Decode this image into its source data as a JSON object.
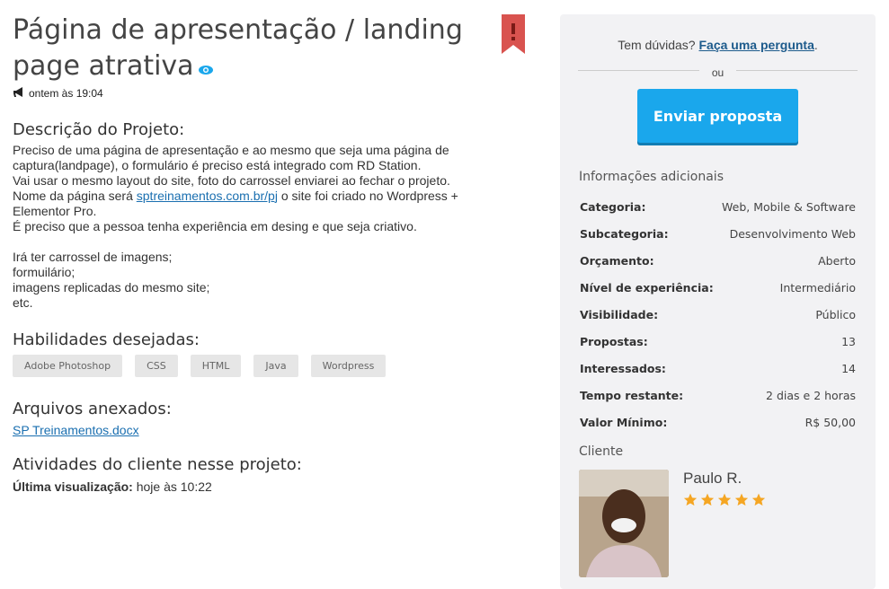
{
  "project": {
    "title": "Página de apresentação / landing page atrativa",
    "posted": "ontem às 19:04"
  },
  "description": {
    "heading": "Descrição do Projeto:",
    "line1": "Preciso de uma página de apresentação e ao mesmo que seja uma página de",
    "line2": "captura(landpage), o formulário é preciso está integrado com RD Station.",
    "line3": "Vai usar o mesmo layout do site, foto do carrossel enviarei ao fechar o projeto.",
    "line4_before": "Nome da página será ",
    "link": "sptreinamentos.com.br/pj",
    "line4_after": " o site foi criado no Wordpress +",
    "line5": "Elementor Pro.",
    "line6": "É preciso que a pessoa tenha experiência em desing e que seja criativo.",
    "line7": "Irá ter carrossel de imagens;",
    "line8": "formuilário;",
    "line9": "imagens replicadas do mesmo site;",
    "line10": "etc."
  },
  "skills": {
    "heading": "Habilidades desejadas:",
    "items": [
      "Adobe Photoshop",
      "CSS",
      "HTML",
      "Java",
      "Wordpress"
    ]
  },
  "files": {
    "heading": "Arquivos anexados:",
    "file1": "SP Treinamentos.docx"
  },
  "activity": {
    "heading": "Atividades do cliente nesse projeto:",
    "label": "Última visualização:",
    "value": "hoje às 10:22"
  },
  "sidebar": {
    "question_text": "Tem dúvidas?",
    "question_link": "Faça uma pergunta",
    "question_end": ".",
    "or": "ou",
    "send_button": "Enviar proposta",
    "info_title": "Informações adicionais",
    "info": [
      {
        "k": "Categoria:",
        "v": "Web, Mobile & Software"
      },
      {
        "k": "Subcategoria:",
        "v": "Desenvolvimento Web"
      },
      {
        "k": "Orçamento:",
        "v": "Aberto"
      },
      {
        "k": "Nível de experiência:",
        "v": "Intermediário"
      },
      {
        "k": "Visibilidade:",
        "v": "Público"
      },
      {
        "k": "Propostas:",
        "v": "13"
      },
      {
        "k": "Interessados:",
        "v": "14"
      },
      {
        "k": "Tempo restante:",
        "v": "2 dias e 2 horas"
      },
      {
        "k": "Valor Mínimo:",
        "v": "R$ 50,00"
      }
    ],
    "client_title": "Cliente",
    "client_name": "Paulo R.",
    "client_rating": 5
  },
  "colors": {
    "accent": "#1aa7ec",
    "link": "#1a6fb0",
    "star": "#f5a623",
    "bookmark": "#d9534f"
  }
}
